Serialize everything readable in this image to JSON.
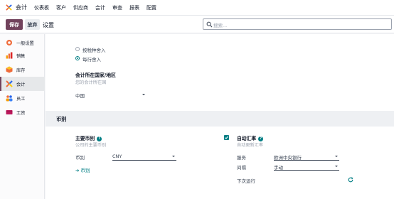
{
  "nav": {
    "app_name": "会计",
    "items": [
      "仪表板",
      "客户",
      "供应商",
      "会计",
      "审查",
      "报表",
      "配置"
    ]
  },
  "control": {
    "save_label": "保存",
    "discard_label": "放弃",
    "title": "设置",
    "search_placeholder": "搜索..."
  },
  "sidebar": {
    "items": [
      {
        "label": "一般设置",
        "icon": "general-settings-icon"
      },
      {
        "label": "销售",
        "icon": "sales-icon"
      },
      {
        "label": "库存",
        "icon": "inventory-icon"
      },
      {
        "label": "会计",
        "icon": "accounting-icon"
      },
      {
        "label": "员工",
        "icon": "employees-icon"
      },
      {
        "label": "工资",
        "icon": "payroll-icon"
      }
    ],
    "active_index": 3
  },
  "rounding": {
    "options": [
      "按税种舍入",
      "每行舍入"
    ],
    "selected_index": 1
  },
  "country": {
    "title": "会计所在国家/地区",
    "description": "您的会计所在国",
    "value": "中国"
  },
  "currency_section": {
    "title": "币别",
    "main_currency": {
      "title": "主要币别",
      "description": "公司的主要币别",
      "field_label": "币别",
      "value": "CNY",
      "link_label": "币别"
    },
    "auto_rate": {
      "enabled": true,
      "title": "自动汇率",
      "description": "自动更新汇率",
      "service_label": "服务",
      "service_value": "欧洲中央银行",
      "interval_label": "间隔",
      "interval_value": "手动",
      "next_run_label": "下次运行"
    }
  },
  "colors": {
    "brand": "#71425c",
    "accent": "#017e84"
  }
}
